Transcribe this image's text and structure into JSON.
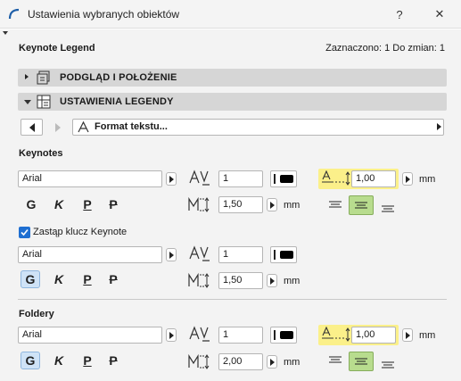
{
  "window": {
    "title": "Ustawienia wybranych obiektów",
    "help": "?",
    "close": "✕"
  },
  "header": {
    "title": "Keynote Legend",
    "selection_info": "Zaznaczono: 1 Do zmian: 1"
  },
  "sections": {
    "preview": "PODGLĄD I POŁOŻENIE",
    "legend": "USTAWIENIA LEGENDY"
  },
  "nav": {
    "format_label": "Format tekstu..."
  },
  "keynotes": {
    "title": "Keynotes",
    "font": "Arial",
    "pen": "1",
    "line_spacing": "1,00",
    "line_spacing_unit": "mm",
    "size": "1,50",
    "size_unit": "mm",
    "style": {
      "bold": "G",
      "italic": "K",
      "underline": "P",
      "strike": "P"
    },
    "align_selected": "center"
  },
  "replace": {
    "label": "Zastąp klucz Keynote",
    "checked": true
  },
  "replace_font": {
    "font": "Arial",
    "pen": "1",
    "size": "1,50",
    "size_unit": "mm",
    "style": {
      "bold": "G",
      "italic": "K",
      "underline": "P",
      "strike": "P"
    },
    "bold_active": true
  },
  "folders": {
    "title": "Foldery",
    "font": "Arial",
    "pen": "1",
    "line_spacing": "1,00",
    "line_spacing_unit": "mm",
    "size": "2,00",
    "size_unit": "mm",
    "style": {
      "bold": "G",
      "italic": "K",
      "underline": "P",
      "strike": "P"
    },
    "bold_active": true,
    "align_selected": "center"
  },
  "colors": {
    "highlight": "#fbf08a",
    "align_active": "#b8dc8e",
    "style_active": "#cfe3f7"
  }
}
